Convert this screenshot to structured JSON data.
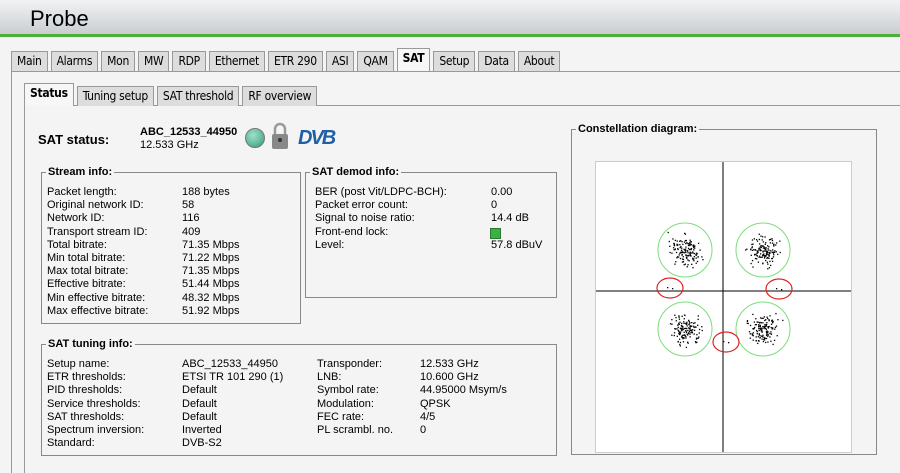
{
  "app_title": "Probe",
  "main_tabs": [
    "Main",
    "Alarms",
    "Mon",
    "MW",
    "RDP",
    "Ethernet",
    "ETR 290",
    "ASI",
    "QAM",
    "SAT",
    "Setup",
    "Data",
    "About"
  ],
  "active_main_tab": "SAT",
  "sub_tabs": [
    "Status",
    "Tuning setup",
    "SAT threshold",
    "RF overview"
  ],
  "active_sub_tab": "Status",
  "sat_status": {
    "label": "SAT status:",
    "name": "ABC_12533_44950",
    "freq": "12.533 GHz",
    "logo": "DVB"
  },
  "stream_info": {
    "title": "Stream info:",
    "rows": [
      [
        "Packet length:",
        "188 bytes"
      ],
      [
        "Original network ID:",
        "58"
      ],
      [
        "Network ID:",
        "116"
      ],
      [
        "Transport stream ID:",
        "409"
      ],
      [
        "Total bitrate:",
        "71.35 Mbps"
      ],
      [
        "Min total bitrate:",
        "71.22 Mbps"
      ],
      [
        "Max total bitrate:",
        "71.35 Mbps"
      ],
      [
        "Effective bitrate:",
        "51.44 Mbps"
      ],
      [
        "Min effective bitrate:",
        "48.32 Mbps"
      ],
      [
        "Max effective bitrate:",
        "51.92 Mbps"
      ]
    ]
  },
  "demod_info": {
    "title": "SAT demod info:",
    "rows": [
      [
        "BER (post Vit/LDPC-BCH):",
        "0.00"
      ],
      [
        "Packet error count:",
        "0"
      ],
      [
        "Signal to noise ratio:",
        "14.4 dB"
      ],
      [
        "Front-end lock:",
        ""
      ],
      [
        "Level:",
        "57.8 dBuV"
      ]
    ]
  },
  "tuning_info": {
    "title": "SAT tuning info:",
    "left": [
      [
        "Setup name:",
        "ABC_12533_44950"
      ],
      [
        "ETR thresholds:",
        "ETSI TR 101 290 (1)"
      ],
      [
        "PID thresholds:",
        "Default"
      ],
      [
        "Service thresholds:",
        "Default"
      ],
      [
        "SAT thresholds:",
        "Default"
      ],
      [
        "Spectrum inversion:",
        "Inverted"
      ],
      [
        "Standard:",
        "DVB-S2"
      ]
    ],
    "right": [
      [
        "Transponder:",
        "12.533 GHz"
      ],
      [
        "LNB:",
        "10.600 GHz"
      ],
      [
        "Symbol rate:",
        "44.95000 Msym/s"
      ],
      [
        "Modulation:",
        "QPSK"
      ],
      [
        "FEC rate:",
        "4/5"
      ],
      [
        "PL scrambl. no.",
        "0"
      ]
    ]
  },
  "constellation": {
    "title": "Constellation diagram:",
    "modulation": "QPSK"
  },
  "colors": {
    "accent": "#4caf3a",
    "lock": "#3cb043",
    "status_led": "#5fb89a",
    "dvb": "#1f5fa8"
  }
}
